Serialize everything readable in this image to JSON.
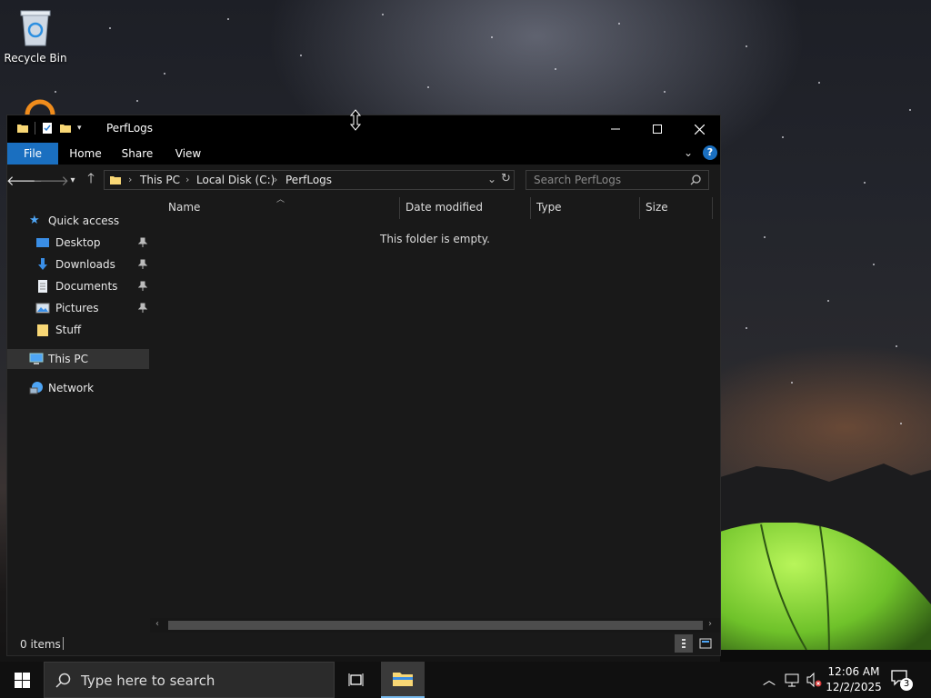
{
  "desktop": {
    "icons": [
      {
        "label": "Recycle Bin"
      }
    ]
  },
  "explorer": {
    "title": "PerfLogs",
    "ribbon_tabs": [
      {
        "label": "File"
      },
      {
        "label": "Home"
      },
      {
        "label": "Share"
      },
      {
        "label": "View"
      }
    ],
    "breadcrumb": [
      "This PC",
      "Local Disk (C:)",
      "PerfLogs"
    ],
    "search_placeholder": "Search PerfLogs",
    "nav_pane": {
      "quick_access": "Quick access",
      "pinned": [
        {
          "label": "Desktop",
          "icon": "desktop-icon",
          "pinned": true
        },
        {
          "label": "Downloads",
          "icon": "downloads-icon",
          "pinned": true
        },
        {
          "label": "Documents",
          "icon": "documents-icon",
          "pinned": true
        },
        {
          "label": "Pictures",
          "icon": "pictures-icon",
          "pinned": true
        },
        {
          "label": "Stuff",
          "icon": "folder-icon",
          "pinned": false
        }
      ],
      "this_pc": "This PC",
      "network": "Network"
    },
    "columns": [
      "Name",
      "Date modified",
      "Type",
      "Size"
    ],
    "empty_message": "This folder is empty.",
    "status": {
      "items": "0 items"
    }
  },
  "taskbar": {
    "search_placeholder": "Type here to search",
    "time": "12:06 AM",
    "date": "12/2/2025",
    "notification_count": "3"
  },
  "colors": {
    "accent": "#1a6fc0",
    "window_bg": "#191919",
    "titlebar_bg": "#000000",
    "folder_yellow": "#f8d775",
    "taskbar_bg": "#101010"
  }
}
